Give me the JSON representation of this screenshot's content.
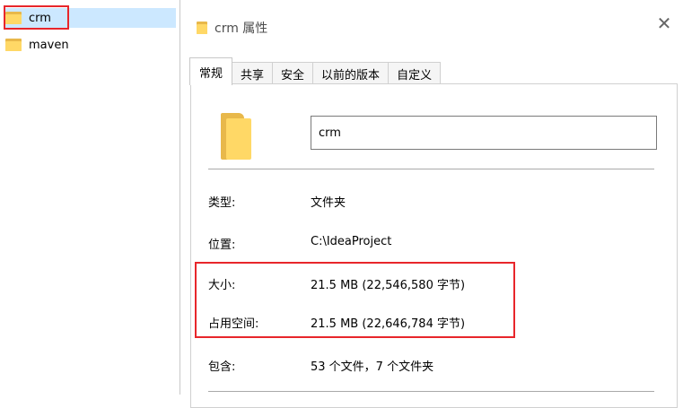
{
  "explorer": {
    "items": [
      {
        "name": "crm",
        "selected": true,
        "icon": "folder-icon"
      },
      {
        "name": "maven",
        "selected": false,
        "icon": "folder-icon"
      }
    ]
  },
  "dialog": {
    "title": "crm 属性",
    "close_glyph": "✕",
    "tabs": [
      {
        "label": "常规",
        "active": true
      },
      {
        "label": "共享",
        "active": false
      },
      {
        "label": "安全",
        "active": false
      },
      {
        "label": "以前的版本",
        "active": false
      },
      {
        "label": "自定义",
        "active": false
      }
    ],
    "name_value": "crm",
    "properties": {
      "type_label": "类型:",
      "type_value": "文件夹",
      "location_label": "位置:",
      "location_value": "C:\\IdeaProject",
      "size_label": "大小:",
      "size_value": "21.5 MB (22,546,580 字节)",
      "disk_label": "占用空间:",
      "disk_value": "21.5 MB (22,646,784 字节)",
      "contains_label": "包含:",
      "contains_value": "53 个文件，7 个文件夹"
    }
  },
  "colors": {
    "highlight": "#e8262b",
    "folder": "#ffd866",
    "selection": "#cce8ff"
  }
}
